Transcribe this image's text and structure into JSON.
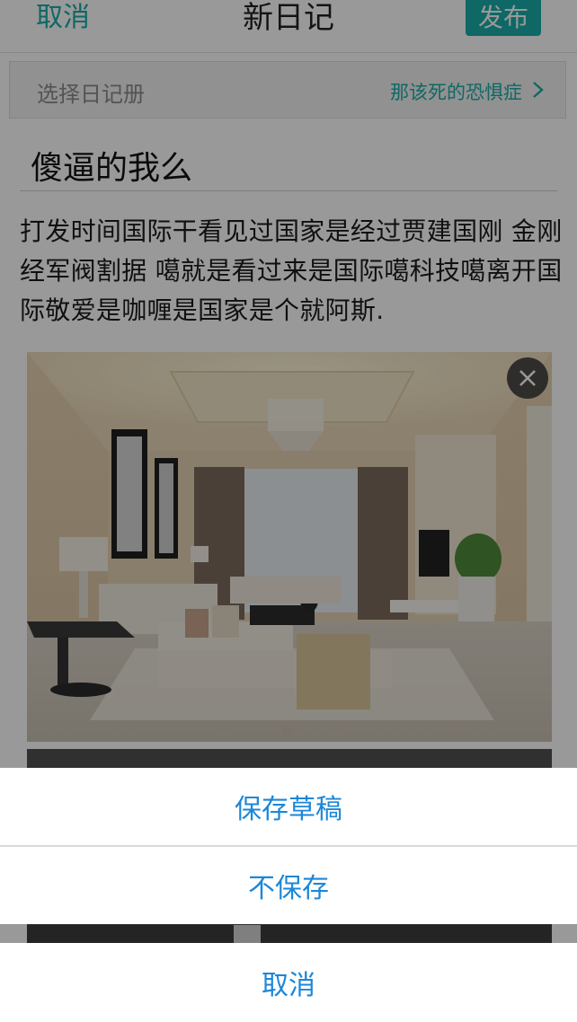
{
  "navbar": {
    "cancel_label": "取消",
    "title": "新日记",
    "publish_label": "发布"
  },
  "diary_picker": {
    "label": "选择日记册",
    "value": "那该死的恐惧症"
  },
  "entry": {
    "title": "傻逼的我么",
    "body": "打发时间国际干看见过国家是经过贾建国刚 金刚经军阀割据 噶就是看过来是国际噶科技噶离开国际敬爱是咖喱是国家是个就阿斯."
  },
  "action_sheet": {
    "save_draft": "保存草稿",
    "dont_save": "不保存",
    "cancel": "取消"
  },
  "colors": {
    "accent": "#1aaea9",
    "sheet_text": "#1c87d8"
  }
}
